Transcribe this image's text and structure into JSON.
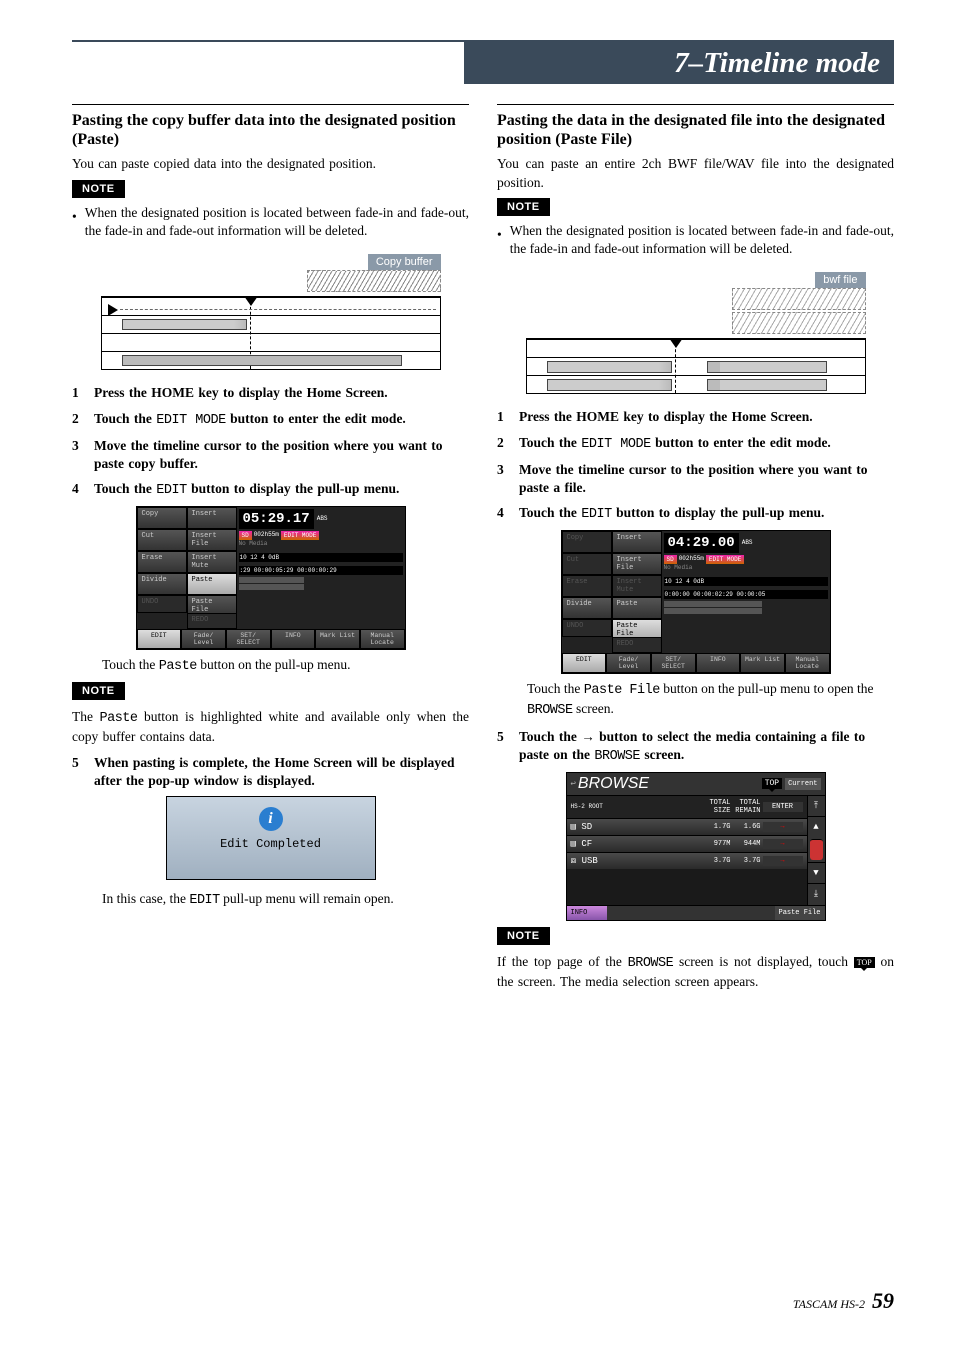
{
  "header": {
    "chapter_title": "7–Timeline mode"
  },
  "left": {
    "heading": "Pasting the copy buffer data into the designated position (Paste)",
    "intro": "You can paste copied data into the designated position.",
    "note1_label": "NOTE",
    "note1_bullet": "When the designated position is located between fade-in and fade-out, the fade-in and fade-out information will be deleted.",
    "fig_label": "Copy buffer",
    "steps": {
      "s1": "Press the HOME key to display the Home Screen.",
      "s2a": "Touch the ",
      "s2_code": "EDIT MODE",
      "s2b": " button to enter the edit mode.",
      "s3": "Move the timeline cursor to the position where you want to paste copy buffer.",
      "s4a": "Touch the ",
      "s4_code": "EDIT",
      "s4b": " button to display the pull-up menu."
    },
    "edit_menu": {
      "copy": "Copy",
      "insert": "Insert",
      "cut": "Cut",
      "insert_file": "Insert File",
      "erase": "Erase",
      "insert_mute": "Insert Mute",
      "divide": "Divide",
      "paste": "Paste",
      "paste_file": "Paste File",
      "undo": "UNDO",
      "redo": "REDO",
      "edit": "EDIT",
      "fade": "Fade/ Level",
      "set": "SET/ SELECT",
      "info": "INFO",
      "mark": "Mark List",
      "manual": "Manual Locate",
      "time": "05:29.17",
      "sd": "SD",
      "timer": "002h55m",
      "mode_btn": "EDIT MODE",
      "nomedia": "No Media",
      "codes": "10   12   4   0dB",
      "range": ":29  00:00:05:29    00:00:00:29",
      "abs": "ABS"
    },
    "touch_paste_a": "Touch the ",
    "touch_paste_code": "Paste",
    "touch_paste_b": " button on the pull-up menu.",
    "note2_label": "NOTE",
    "note2_a": "The ",
    "note2_code": "Paste",
    "note2_b": " button is highlighted white and available only when the copy buffer contains data.",
    "step5": "When pasting is complete, the Home Screen will be displayed after the pop-up window is displayed.",
    "edit_completed": "Edit Completed",
    "final_a": "In this case, the ",
    "final_code": "EDIT",
    "final_b": " pull-up menu will remain open."
  },
  "right": {
    "heading": "Pasting the data in the designated file into the designated position (Paste File)",
    "intro": "You can paste an entire 2ch BWF file/WAV file into the designated position.",
    "note1_label": "NOTE",
    "note1_bullet": "When the designated position is located between fade-in and fade-out, the fade-in and fade-out information will be deleted.",
    "fig_label": "bwf file",
    "steps": {
      "s1": "Press the HOME key to display the Home Screen.",
      "s2a": "Touch the ",
      "s2_code": "EDIT MODE",
      "s2b": " button to enter the edit mode.",
      "s3": "Move the timeline cursor to the position where you want to paste a file.",
      "s4a": "Touch the ",
      "s4_code": "EDIT",
      "s4b": " button to display the pull-up menu."
    },
    "edit_menu": {
      "copy": "Copy",
      "insert": "Insert",
      "cut": "Cut",
      "insert_file": "Insert File",
      "erase": "Erase",
      "insert_mute": "Insert Mute",
      "divide": "Divide",
      "paste": "Paste",
      "paste_file": "Paste File",
      "undo": "UNDO",
      "redo": "REDO",
      "edit": "EDIT",
      "fade": "Fade/ Level",
      "set": "SET/ SELECT",
      "info": "INFO",
      "mark": "Mark List",
      "manual": "Manual Locate",
      "time": "04:29.00",
      "sd": "SD",
      "timer": "002h55m",
      "mode_btn": "EDIT MODE",
      "nomedia": "No Media",
      "codes": "10   12   4   0dB",
      "range": "0:00:00  00:00:02:29  00:00:05",
      "abs": "ABS"
    },
    "touch_paste_a": "Touch the ",
    "touch_paste_code": "Paste File",
    "touch_paste_b": " button on the pull-up menu to open the ",
    "touch_paste_code2": "BROWSE",
    "touch_paste_c": " screen.",
    "step5a": "Touch the ",
    "step5arrow": "→",
    "step5b": " button to select the media containing a file to paste on the ",
    "step5_code": "BROWSE",
    "step5c": " screen.",
    "browse": {
      "title": "BROWSE",
      "top": "TOP",
      "current": "Current",
      "root": "HS-2 ROOT",
      "col_size": "TOTAL SIZE",
      "col_remain": "TOTAL REMAIN",
      "enter": "ENTER",
      "rows": [
        {
          "name": "SD",
          "size": "1.7G",
          "remain": "1.6G"
        },
        {
          "name": "CF",
          "size": "977M",
          "remain": "944M"
        },
        {
          "name": "USB",
          "size": "3.7G",
          "remain": "3.7G"
        }
      ],
      "info": "INFO",
      "paste_file": "Paste File"
    },
    "note2_label": "NOTE",
    "note2_a": "If the top page of the ",
    "note2_code": "BROWSE",
    "note2_b": " screen is not displayed, touch ",
    "note2_icon": "TOP",
    "note2_c": " on the screen. The media selection screen appears."
  },
  "footer": {
    "product": "TASCAM HS-2",
    "page": "59"
  }
}
